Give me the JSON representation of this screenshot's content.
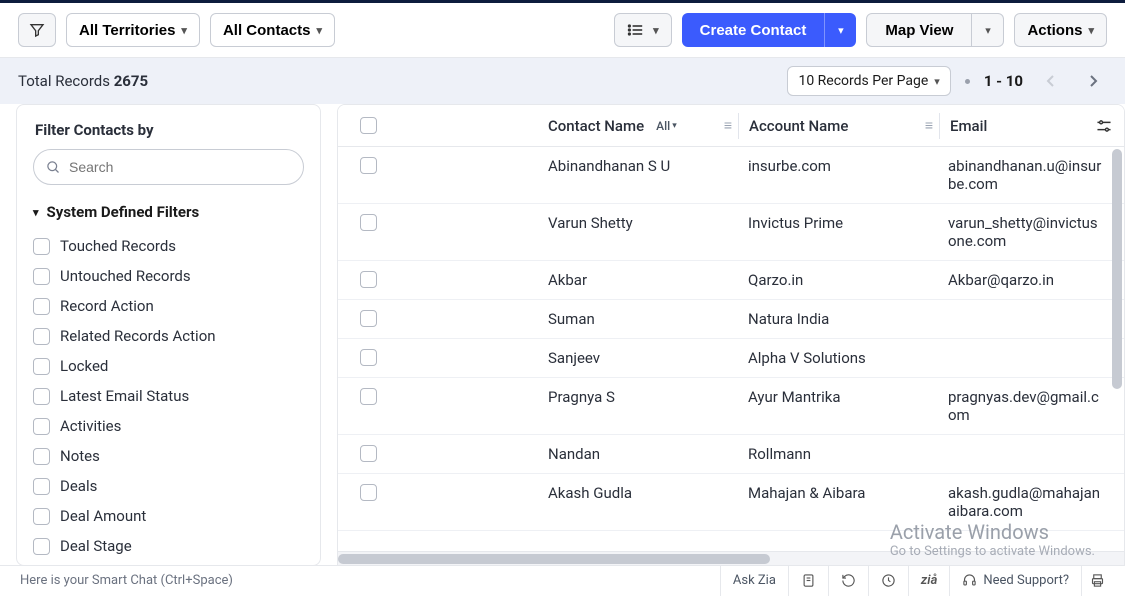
{
  "toolbar": {
    "territories_label": "All Territories",
    "contacts_view_label": "All Contacts",
    "create_label": "Create Contact",
    "map_view_label": "Map View",
    "actions_label": "Actions"
  },
  "subbar": {
    "total_prefix": "Total Records",
    "total_count": "2675",
    "records_per_page_label": "10 Records Per Page",
    "range": "1 - 10"
  },
  "sidebar": {
    "title": "Filter Contacts by",
    "search_placeholder": "Search",
    "group_title": "System Defined Filters",
    "filters": [
      "Touched Records",
      "Untouched Records",
      "Record Action",
      "Related Records Action",
      "Locked",
      "Latest Email Status",
      "Activities",
      "Notes",
      "Deals",
      "Deal Amount",
      "Deal Stage"
    ]
  },
  "table": {
    "columns": {
      "name": "Contact Name",
      "name_filter": "All",
      "account": "Account Name",
      "email": "Email"
    },
    "rows": [
      {
        "name": "Abinandhanan S U",
        "account": "insurbe.com",
        "email": "abinandhanan.u@insurbe.com"
      },
      {
        "name": "Varun Shetty",
        "account": "Invictus Prime",
        "email": "varun_shetty@invictusone.com"
      },
      {
        "name": "Akbar",
        "account": "Qarzo.in",
        "email": "Akbar@qarzo.in"
      },
      {
        "name": "Suman",
        "account": "Natura India",
        "email": ""
      },
      {
        "name": "Sanjeev",
        "account": "Alpha V Solutions",
        "email": ""
      },
      {
        "name": "Pragnya S",
        "account": "Ayur Mantrika",
        "email": "pragnyas.dev@gmail.com"
      },
      {
        "name": "Nandan",
        "account": "Rollmann",
        "email": ""
      },
      {
        "name": "Akash Gudla",
        "account": "Mahajan & Aibara",
        "email": "akash.gudla@mahajanaibara.com"
      }
    ]
  },
  "footer": {
    "smart_chat": "Here is your Smart Chat (Ctrl+Space)",
    "ask_zia": "Ask Zia",
    "support": "Need Support?"
  },
  "watermark": {
    "line1": "Activate Windows",
    "line2": "Go to Settings to activate Windows."
  }
}
